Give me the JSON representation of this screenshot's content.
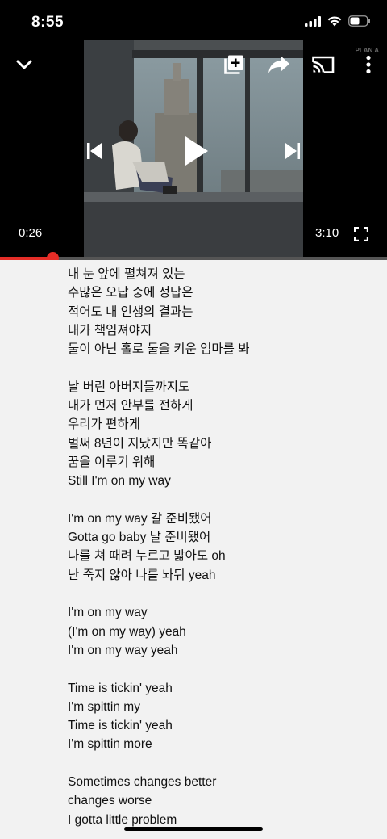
{
  "status_bar": {
    "time": "8:55",
    "icons": [
      "signal-icon",
      "wifi-icon",
      "battery-icon"
    ]
  },
  "player": {
    "current_time": "0:26",
    "duration": "3:10",
    "progress_fraction": 0.137,
    "watermark": "PLAN A",
    "state": "paused",
    "icons": [
      "chevron-down-icon",
      "add-to-playlist-icon",
      "share-icon",
      "cast-icon",
      "more-icon",
      "previous-icon",
      "play-icon",
      "next-icon",
      "fullscreen-icon"
    ]
  },
  "colors": {
    "accent": "#e52d27",
    "lyrics_background": "#f2f2f2",
    "player_background": "#000000"
  },
  "lyrics": [
    "내 눈 앞에 펼쳐져 있는",
    "수많은 오답 중에 정답은",
    "적어도 내 인생의 결과는",
    "내가 책임져야지",
    "둘이 아닌 홀로 둘을 키운 엄마를 봐",
    "",
    "날 버린 아버지들까지도",
    "내가 먼저 안부를 전하게",
    "우리가 편하게",
    "벌써 8년이 지났지만 똑같아",
    "꿈을 이루기 위해",
    "Still I'm on my way",
    "",
    "I'm on my way 갈 준비됐어",
    "Gotta go baby 날 준비됐어",
    "나를 쳐 때려 누르고 밟아도 oh",
    "난 죽지 않아 나를 놔둬 yeah",
    "",
    "I'm on my way",
    "(I'm on my way) yeah",
    "I'm on my way yeah",
    "",
    "Time is tickin' yeah",
    "I'm spittin my",
    "Time is tickin' yeah",
    "I'm spittin more",
    "",
    "Sometimes changes better",
    "changes worse",
    "I gotta little problem"
  ]
}
